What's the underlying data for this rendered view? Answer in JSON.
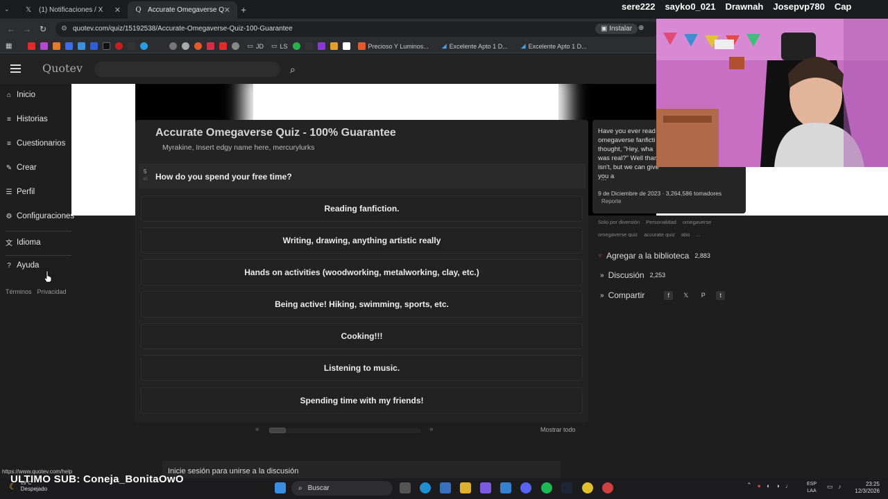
{
  "browser": {
    "tabs": [
      {
        "label": "(1) Notificaciones / X",
        "icon": "x-logo-icon"
      },
      {
        "label": "Accurate Omegaverse Quiz - 1(",
        "icon": "quotev-icon"
      }
    ],
    "url": "quotev.com/quiz/15192538/Accurate-Omegaverse-Quiz-100-Guarantee",
    "install_label": "Instalar",
    "bookmarks": [
      {
        "label": "JD"
      },
      {
        "label": "LS"
      },
      {
        "label": "Precioso Y Luminos..."
      },
      {
        "label": "Excelente Apto 1 D..."
      },
      {
        "label": "Excelente Apto 1 D..."
      }
    ]
  },
  "stream_overlay": {
    "names": [
      "sere222",
      "sayko0_021",
      "Drawnah",
      "Josepvp780",
      "Cap"
    ],
    "last_sub": "ULTIMO SUB: Coneja_BonitaOwO"
  },
  "site": {
    "logo": "Quotev",
    "search_placeholder": ""
  },
  "sidebar": {
    "items": [
      {
        "label": "Inicio",
        "icon": "home-icon"
      },
      {
        "label": "Historias",
        "icon": "list-icon"
      },
      {
        "label": "Cuestionarios",
        "icon": "list-icon"
      },
      {
        "label": "Crear",
        "icon": "pencil-icon"
      },
      {
        "label": "Perfil",
        "icon": "profile-icon"
      },
      {
        "label": "Configuraciones",
        "icon": "gear-icon"
      },
      {
        "label": "Idioma",
        "icon": "translate-icon"
      },
      {
        "label": "Ayuda",
        "icon": "help-icon"
      }
    ],
    "links": [
      "Términos",
      "Privacidad"
    ]
  },
  "quiz": {
    "title": "Accurate Omegaverse Quiz - 100% Guarantee",
    "authors": "Myrakine, Insert edgy name here, mercurylurks",
    "question_number": "5",
    "question_total": "45",
    "question": "How do you spend your free time?",
    "answers": [
      "Reading fanfiction.",
      "Writing, drawing, anything artistic really",
      "Hands on activities (woodworking, metalworking, clay, etc.)",
      "Being active! Hiking, swimming, sports, etc.",
      "Cooking!!!",
      "Listening to music.",
      "Spending time with my friends!"
    ],
    "pager_prev": "«",
    "pager_next": "»",
    "show_all": "Mostrar todo",
    "discussion_prompt": "Inicie sesión para unirse a la discusión"
  },
  "info": {
    "description": "Have you ever read omegaverse fanficti thought, \"Hey, wha was real?\" Well thar isn't, but we can give you a",
    "ellipsis": "...",
    "meta": "9 de Diciembre de 2023 · 3,264,586 tomadores",
    "report": "Reporte",
    "tags": [
      "Solo por diversión",
      "Personalidad",
      "omegaverse",
      "omegaverse quiz",
      "accurate quiz",
      "abo",
      "..."
    ],
    "library_label": "Agregar a la biblioteca",
    "library_count": "2,883",
    "discussion_label": "Discusión",
    "discussion_count": "2,253",
    "share_label": "Compartir",
    "share_icons": [
      "facebook-icon",
      "x-icon",
      "pinterest-icon",
      "tumblr-icon"
    ]
  },
  "status_url": "https://www.quotev.com/help",
  "taskbar": {
    "weather_temp": "19°C",
    "weather_text": "Despejado",
    "search_label": "Buscar",
    "lang_line1": "ESP",
    "lang_line2": "LAA",
    "time": "23:25",
    "date": "12/3/2026"
  },
  "colors": {
    "accent_heart": "#c0303a",
    "background": "#1e1e1e"
  }
}
